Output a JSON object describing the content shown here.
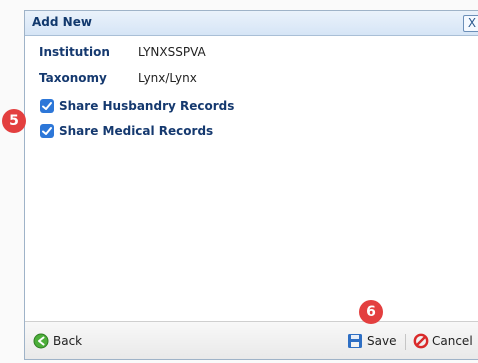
{
  "dialog": {
    "title": "Add New",
    "close_label": "X"
  },
  "fields": {
    "institution_label": "Institution",
    "institution_value": "LYNXSSPVA",
    "taxonomy_label": "Taxonomy",
    "taxonomy_value": "Lynx/Lynx"
  },
  "checkboxes": [
    {
      "label": "Share Husbandry Records",
      "checked": true
    },
    {
      "label": "Share Medical Records",
      "checked": true
    }
  ],
  "footer": {
    "back_label": "Back",
    "save_label": "Save",
    "cancel_label": "Cancel"
  },
  "annotations": {
    "marker_5": "5",
    "marker_6": "6"
  },
  "colors": {
    "title_text": "#12396d",
    "checkbox_blue": "#2d77d8",
    "marker_red": "#e33f3f"
  }
}
